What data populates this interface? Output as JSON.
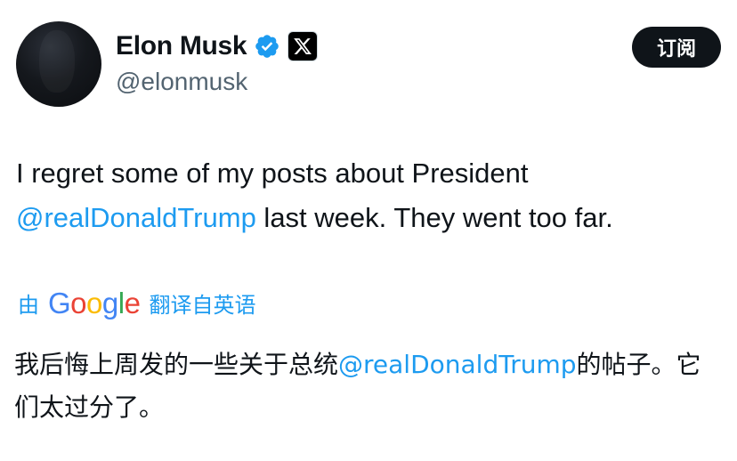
{
  "author": {
    "display_name": "Elon Musk",
    "handle": "@elonmusk",
    "avatar_icon": "profile-photo",
    "verified_icon": "verified-badge-icon",
    "affiliate_icon": "x-logo-icon",
    "affiliate_glyph": "𝕏"
  },
  "subscribe": {
    "label": "订阅"
  },
  "post": {
    "text_before": "I regret some of my posts about President ",
    "mention": "@realDonaldTrump",
    "text_after": " last week. They went too far."
  },
  "translation": {
    "prefix": "由",
    "provider_letters": [
      "G",
      "o",
      "o",
      "g",
      "l",
      "e"
    ],
    "suffix": "翻译自英语",
    "text_before": "我后悔上周发的一些关于总统",
    "mention": "@realDonaldTrump",
    "text_after": "的帖子。它们太过分了。"
  },
  "colors": {
    "link": "#1d9bf0",
    "text": "#0f1419",
    "secondary": "#536471",
    "verified": "#1d9bf0",
    "google_blue": "#4285F4",
    "google_red": "#EA4335",
    "google_yellow": "#FBBC05",
    "google_green": "#34A853"
  }
}
